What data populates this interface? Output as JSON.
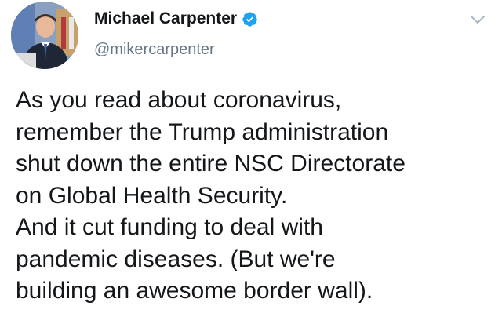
{
  "author": {
    "name": "Michael Carpenter",
    "handle": "@mikercarpenter",
    "verified": true
  },
  "tweet": {
    "lines": [
      "As you read about coronavirus,",
      "remember the Trump administration",
      "shut down the entire NSC Directorate",
      "on Global Health Security.",
      "And it cut funding to deal with",
      "pandemic diseases. (But we're",
      "building an awesome border wall)."
    ]
  },
  "colors": {
    "text": "#14171a",
    "secondary": "#657786",
    "verified": "#1da1f2",
    "caret": "#aab8c2"
  },
  "icons": {
    "verified": "verified-badge-icon",
    "caret": "chevron-down-icon"
  }
}
